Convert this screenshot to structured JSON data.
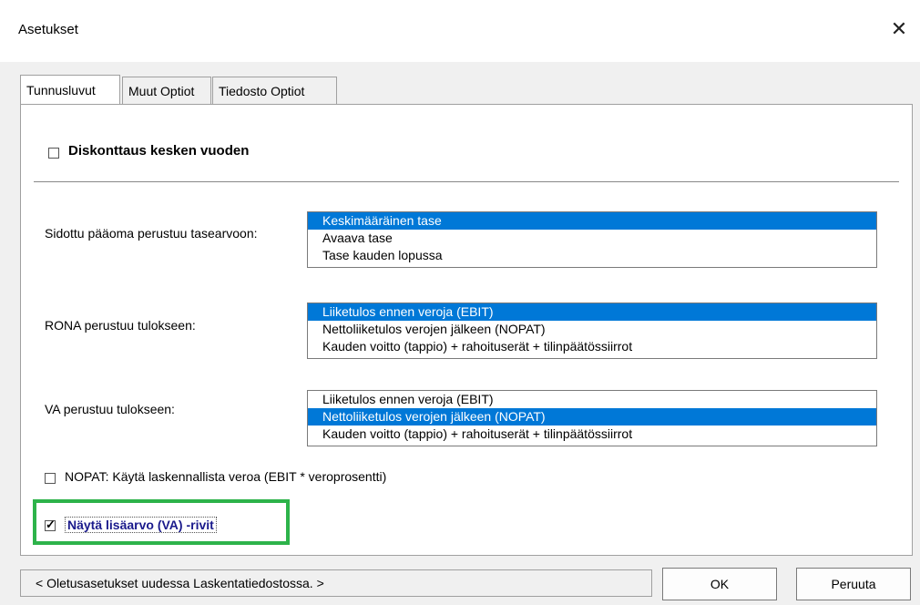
{
  "window": {
    "title": "Asetukset",
    "close_glyph": "✕"
  },
  "tabs": [
    {
      "label": "Tunnusluvut",
      "active": true
    },
    {
      "label": "Muut Optiot",
      "active": false
    },
    {
      "label": "Tiedosto Optiot",
      "active": false
    }
  ],
  "discount": {
    "label": "Diskonttaus kesken vuoden",
    "checked": false
  },
  "capital": {
    "label": "Sidottu pääoma perustuu tasearvoon:",
    "options": [
      "Keskimääräinen tase",
      "Avaava tase",
      "Tase kauden lopussa"
    ],
    "selected": "Keskimääräinen tase"
  },
  "rona": {
    "label": "RONA perustuu tulokseen:",
    "options": [
      "Liiketulos ennen veroja (EBIT)",
      "Nettoliiketulos verojen jälkeen (NOPAT)",
      "Kauden voitto (tappio) + rahoituserät + tilinpäätössiirrot"
    ],
    "selected": "Liiketulos ennen veroja (EBIT)"
  },
  "va": {
    "label": "VA perustuu tulokseen:",
    "options": [
      "Liiketulos ennen veroja (EBIT)",
      "Nettoliiketulos verojen jälkeen (NOPAT)",
      "Kauden voitto (tappio) + rahoituserät + tilinpäätössiirrot"
    ],
    "selected": "Nettoliiketulos verojen jälkeen (NOPAT)"
  },
  "nopat": {
    "label": "NOPAT: Käytä laskennallista veroa (EBIT * veroprosentti)",
    "checked": false
  },
  "show_va": {
    "label": "Näytä lisäarvo (VA) -rivit",
    "checked": true
  },
  "footer": {
    "status": "< Oletusasetukset uudessa Laskentatiedostossa. >",
    "ok_label": "OK",
    "cancel_label": "Peruuta"
  },
  "colors": {
    "selection": "#0078d7",
    "highlight_border": "#2db34a",
    "emphasis_text": "#1a1a8c"
  }
}
